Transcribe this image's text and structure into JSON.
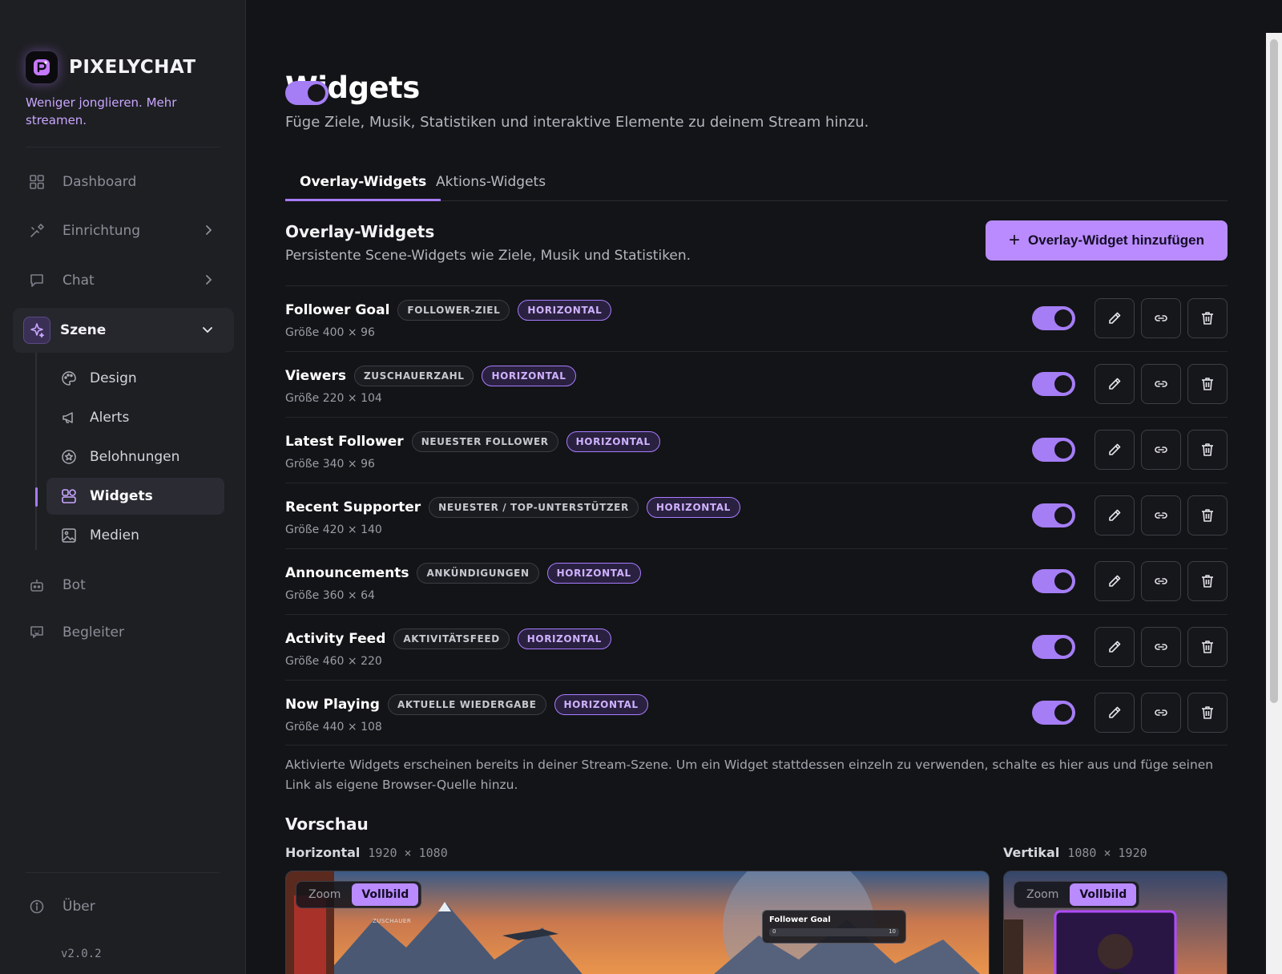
{
  "app": {
    "brand": "PIXELYCHAT",
    "tagline": "Weniger jonglieren. Mehr streamen.",
    "version": "v2.0.2",
    "accent": "#b98bff"
  },
  "sidebar": {
    "items": [
      {
        "label": "Dashboard",
        "icon": "grid-icon"
      },
      {
        "label": "Einrichtung",
        "icon": "tools-icon"
      },
      {
        "label": "Chat",
        "icon": "chat-bubble-icon"
      },
      {
        "label": "Szene",
        "icon": "sparkle-icon"
      },
      {
        "label": "Bot",
        "icon": "robot-icon"
      },
      {
        "label": "Begleiter",
        "icon": "companion-icon"
      },
      {
        "label": "Über",
        "icon": "info-icon"
      }
    ],
    "sub_items": [
      {
        "label": "Design",
        "icon": "palette-icon"
      },
      {
        "label": "Alerts",
        "icon": "megaphone-icon"
      },
      {
        "label": "Belohnungen",
        "icon": "star-badge-icon"
      },
      {
        "label": "Widgets",
        "icon": "widgets-icon"
      },
      {
        "label": "Medien",
        "icon": "image-icon"
      }
    ]
  },
  "page": {
    "title": "Widgets",
    "subtitle": "Füge Ziele, Musik, Statistiken und interaktive Elemente zu deinem Stream hinzu."
  },
  "tabs": [
    "Overlay-Widgets",
    "Aktions-Widgets"
  ],
  "section": {
    "title": "Overlay-Widgets",
    "subtitle": "Persistente Scene-Widgets wie Ziele, Musik und Statistiken.",
    "add_button": "Overlay-Widget hinzufügen"
  },
  "widgets": [
    {
      "name": "Follower Goal",
      "type": "FOLLOWER-ZIEL",
      "orientation": "HORIZONTAL",
      "size": "Größe 400 × 96"
    },
    {
      "name": "Viewers",
      "type": "ZUSCHAUERZAHL",
      "orientation": "HORIZONTAL",
      "size": "Größe 220 × 104"
    },
    {
      "name": "Latest Follower",
      "type": "NEUESTER FOLLOWER",
      "orientation": "HORIZONTAL",
      "size": "Größe 340 × 96"
    },
    {
      "name": "Recent Supporter",
      "type": "NEUESTER / TOP-UNTERSTÜTZER",
      "orientation": "HORIZONTAL",
      "size": "Größe 420 × 140"
    },
    {
      "name": "Announcements",
      "type": "ANKÜNDIGUNGEN",
      "orientation": "HORIZONTAL",
      "size": "Größe 360 × 64"
    },
    {
      "name": "Activity Feed",
      "type": "AKTIVITÄTSFEED",
      "orientation": "HORIZONTAL",
      "size": "Größe 460 × 220"
    },
    {
      "name": "Now Playing",
      "type": "AKTUELLE WIEDERGABE",
      "orientation": "HORIZONTAL",
      "size": "Größe 440 × 108"
    }
  ],
  "note": "Aktivierte Widgets erscheinen bereits in deiner Stream-Szene. Um ein Widget stattdessen einzeln zu verwenden, schalte es hier aus und füge seinen Link als eigene Browser-Quelle hinzu.",
  "preview": {
    "title": "Vorschau",
    "horizontal_label": "Horizontal",
    "horizontal_dim": "1920 × 1080",
    "vertical_label": "Vertikal",
    "vertical_dim": "1080 × 1920",
    "zoom": "Zoom",
    "fullscreen": "Vollbild",
    "mini_goal_title": "Follower Goal",
    "mini_goal_min": "0",
    "mini_goal_max": "10",
    "mini_viewers_label": "ZUSCHAUER"
  }
}
